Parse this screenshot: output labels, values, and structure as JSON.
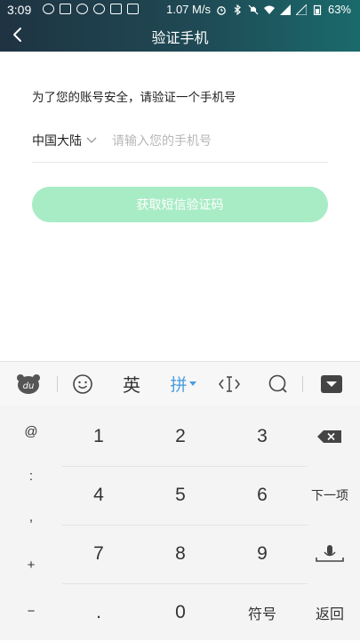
{
  "status_bar": {
    "time": "3:09",
    "speed": "1.07 M/s",
    "battery": "63%"
  },
  "header": {
    "title": "验证手机"
  },
  "form": {
    "prompt": "为了您的账号安全，请验证一个手机号",
    "country": "中国大陆",
    "phone_placeholder": "请输入您的手机号",
    "get_code_label": "获取短信验证码"
  },
  "keyboard": {
    "toolbar": {
      "english_label": "英",
      "pinyin_label": "拼"
    },
    "side_keys": [
      "@",
      ":",
      ",",
      "+",
      "−"
    ],
    "rows": [
      [
        "1",
        "2",
        "3"
      ],
      [
        "4",
        "5",
        "6"
      ],
      [
        "7",
        "8",
        "9"
      ],
      [
        ".",
        "0",
        "符号"
      ]
    ],
    "right_keys": {
      "next": "下一项",
      "return": "返回"
    }
  },
  "colors": {
    "header_gradient_start": "#1f3342",
    "header_gradient_end": "#1a6a6c",
    "button": "#a8ecc5",
    "accent_blue": "#4a9de0"
  }
}
